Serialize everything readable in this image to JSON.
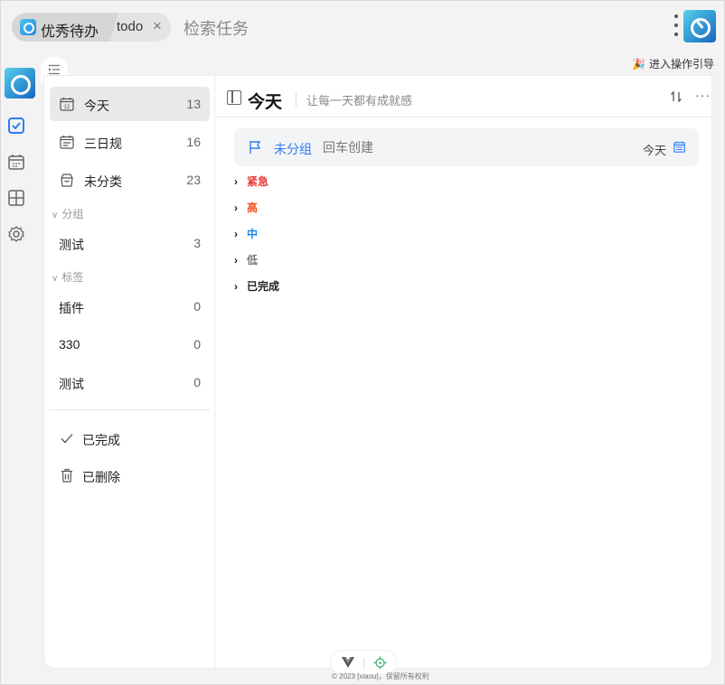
{
  "topbar": {
    "app_name": "优秀待办",
    "tab_name": "todo",
    "close_glyph": "×",
    "search_placeholder": "检索任务",
    "guide_label": "进入操作引导"
  },
  "sidebar": {
    "smart_lists": [
      {
        "label": "今天",
        "count": "13",
        "icon": "calendar-today-icon"
      },
      {
        "label": "三日规",
        "count": "16",
        "icon": "calendar-range-icon"
      },
      {
        "label": "未分类",
        "count": "23",
        "icon": "inbox-box-icon"
      }
    ],
    "groups_section": "分组",
    "groups": [
      {
        "label": "测试",
        "count": "3"
      }
    ],
    "tags_section": "标签",
    "tags": [
      {
        "label": "插件",
        "count": "0"
      },
      {
        "label": "330",
        "count": "0"
      },
      {
        "label": "测试",
        "count": "0"
      }
    ],
    "completed_label": "已完成",
    "deleted_label": "已删除"
  },
  "content": {
    "title": "今天",
    "subtitle": "让每一天都有成就感",
    "add_bar": {
      "group_label": "未分组",
      "placeholder": "回车创建",
      "date_label": "今天"
    },
    "priorities": [
      {
        "label": "紧急",
        "color": "#e53935"
      },
      {
        "label": "高",
        "color": "#f4511e"
      },
      {
        "label": "中",
        "color": "#1e88e5"
      },
      {
        "label": "低",
        "color": "#777777"
      },
      {
        "label": "已完成",
        "color": "#222222"
      }
    ]
  },
  "footer": {
    "copyright": "© 2023 [xiaou]，保留所有权利"
  },
  "colors": {
    "accent": "#2d7cf6",
    "active_item_bg": "#e9e9e9"
  }
}
